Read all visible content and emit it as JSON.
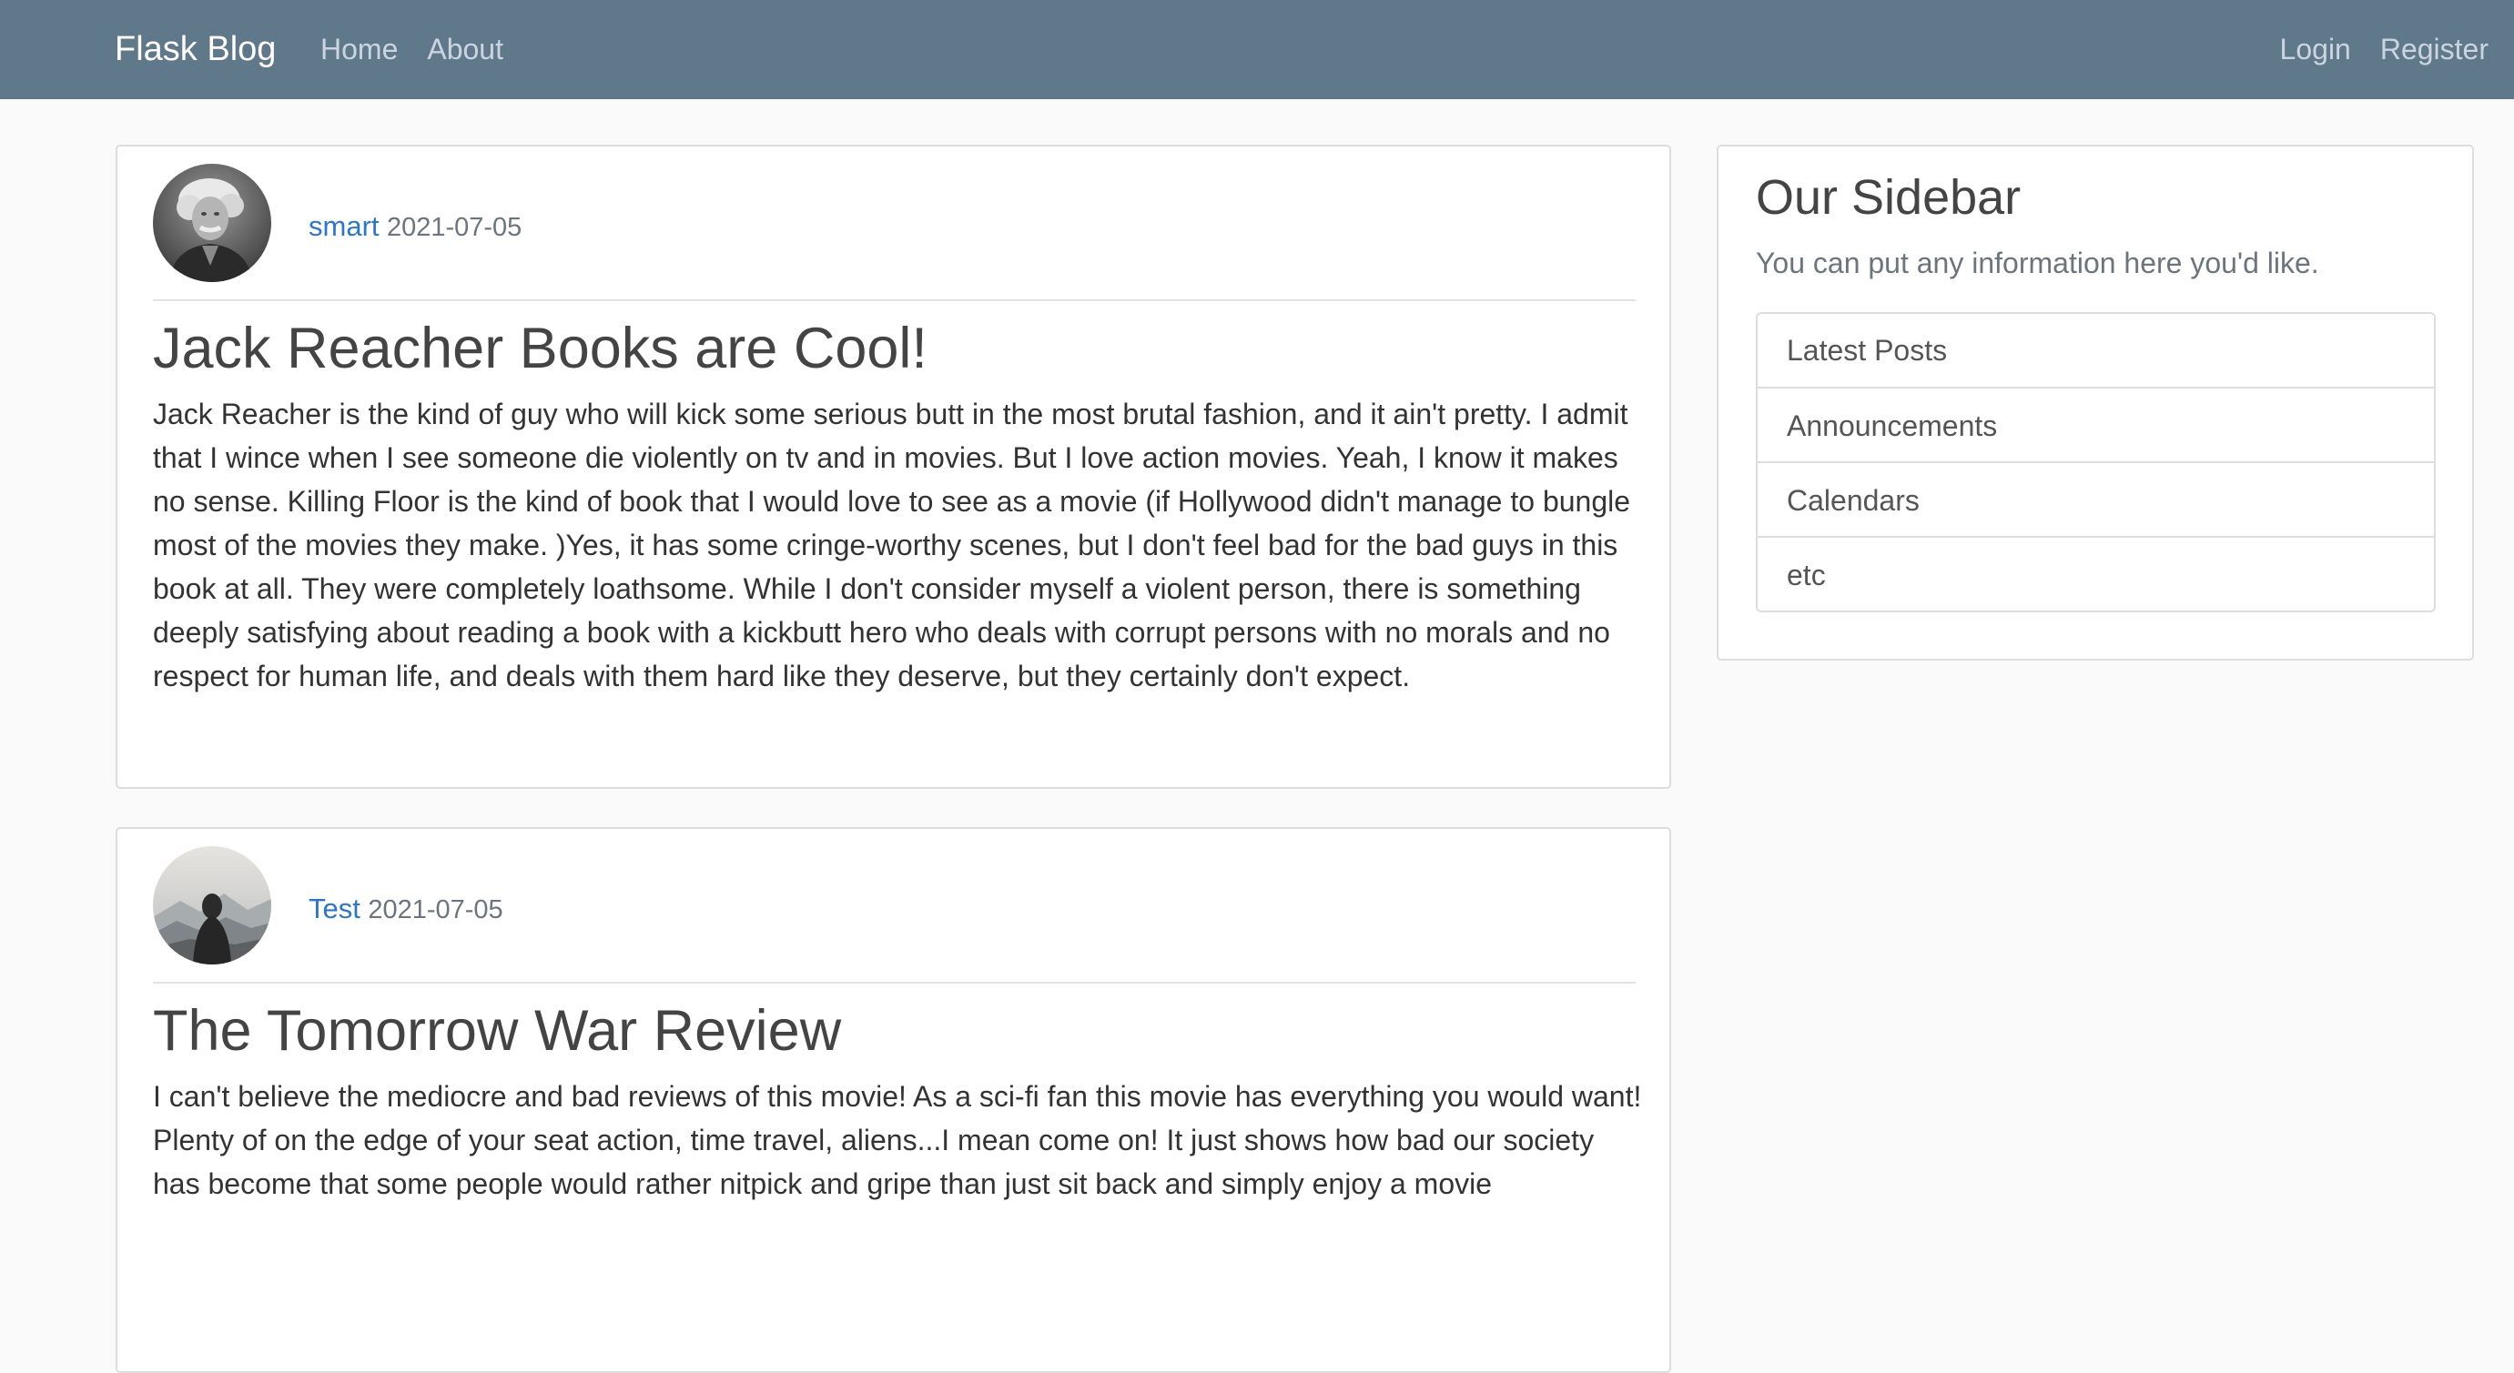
{
  "navbar": {
    "brand": "Flask Blog",
    "left_links": [
      "Home",
      "About"
    ],
    "right_links": [
      "Login",
      "Register"
    ]
  },
  "posts": [
    {
      "author": "smart",
      "date": "2021-07-05",
      "avatar": "author-portrait-photo",
      "title": "Jack Reacher Books are Cool!",
      "content": "Jack Reacher is the kind of guy who will kick some serious butt in the most brutal fashion, and it ain't pretty. I admit that I wince when I see someone die violently on tv and in movies. But I love action movies. Yeah, I know it makes no sense. Killing Floor is the kind of book that I would love to see as a movie (if Hollywood didn't manage to bungle most of the movies they make. )Yes, it has some cringe-worthy scenes, but I don't feel bad for the bad guys in this book at all. They were completely loathsome. While I don't consider myself a violent person, there is something deeply satisfying about reading a book with a kickbutt hero who deals with corrupt persons with no morals and no respect for human life, and deals with them hard like they deserve, but they certainly don't expect."
    },
    {
      "author": "Test",
      "date": "2021-07-05",
      "avatar": "hooded-figure-mountains-photo",
      "title": "The Tomorrow War Review",
      "content": "I can't believe the mediocre and bad reviews of this movie! As a sci-fi fan this movie has everything you would want! Plenty of on the edge of your seat action, time travel, aliens...I mean come on! It just shows how bad our society has become that some people would rather nitpick and gripe than just sit back and simply enjoy a movie"
    }
  ],
  "sidebar": {
    "title": "Our Sidebar",
    "text": "You can put any information here you'd like.",
    "items": [
      "Latest Posts",
      "Announcements",
      "Calendars",
      "etc"
    ]
  },
  "colors": {
    "navbar_bg": "#5f788a",
    "page_bg": "#fafafa",
    "link": "#2c76d1",
    "muted": "#6c757d"
  }
}
